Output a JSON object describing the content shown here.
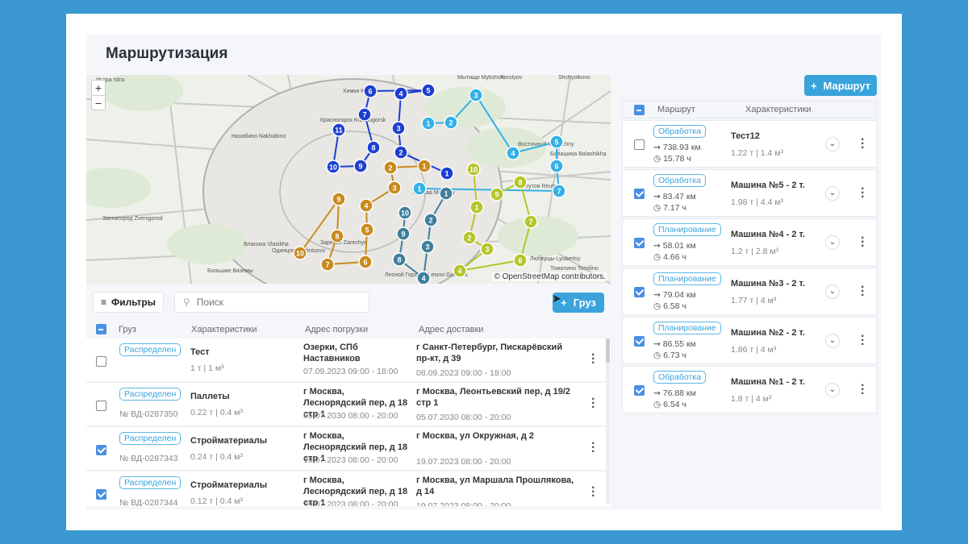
{
  "page": {
    "title": "Маршрутизация"
  },
  "map": {
    "zoom_in": "+",
    "zoom_out": "−",
    "attribution": "© OpenStreetMap contributors.",
    "labels": [
      "Истра Istra",
      "Химки Khimki",
      "Мытищи Mytishchi",
      "Korolyov",
      "Shchyolkovo",
      "Нахабино Nakhabino",
      "Красногорск Krasnogorsk",
      "Москва Moscow",
      "Восточный Vostochny",
      "Балашиха Balashikha",
      "Реутов Reutov",
      "Звенигород Zvenigorod",
      "Заречье Zarechye",
      "Власиха Vlasikha",
      "Одинцово Odintsovo",
      "Люберцы Lyubertsy",
      "Томилино Tomilino",
      "Лесной Городок Lesnoi Gorodok",
      "Большие Вяземы"
    ],
    "routes": [
      {
        "color": "#1c3fd1",
        "markers": [
          "1",
          "2",
          "3",
          "4",
          "5",
          "6",
          "7",
          "8",
          "9",
          "10",
          "11"
        ]
      },
      {
        "color": "#34b0e8",
        "markers": [
          "1",
          "2",
          "3",
          "4",
          "5",
          "6",
          "7",
          "1"
        ]
      },
      {
        "color": "#c98b1e",
        "markers": [
          "1",
          "2",
          "3",
          "4",
          "5",
          "6",
          "7",
          "8",
          "9",
          "10"
        ]
      },
      {
        "color": "#3f7f9e",
        "markers": [
          "1",
          "2",
          "3",
          "4",
          "8",
          "9",
          "10"
        ]
      },
      {
        "color": "#b6c52b",
        "markers": [
          "10",
          "1",
          "2",
          "3",
          "4",
          "6",
          "7",
          "8",
          "9"
        ]
      }
    ]
  },
  "toolbar": {
    "filters": "Фильтры",
    "search_placeholder": "Поиск",
    "add_cargo": "Груз",
    "add_route": "Маршрут"
  },
  "cargo_table": {
    "headers": [
      "Груз",
      "Характеристики",
      "Адрес погрузки",
      "Адрес доставки"
    ],
    "rows": [
      {
        "checked": false,
        "status": "Распределен",
        "number": "",
        "name": "Тест",
        "specs": "1 т | 1 м³",
        "load_addr": "Озерки, СПб Наставников",
        "load_time": "07.09.2023 09:00 - 18:00",
        "del_addr": "г Санкт-Петербург, Пискарёвский пр-кт, д 39",
        "del_time": "08.09.2023 09:00 - 18:00"
      },
      {
        "checked": false,
        "status": "Распределен",
        "number": "№ ВД-0287350",
        "name": "Паллеты",
        "specs": "0.22 т | 0.4 м³",
        "load_addr": "г Москва, Леснорядский пер, д 18 стр 1",
        "load_time": "05.07.2030 08:00 - 20:00",
        "del_addr": "г Москва, Леонтьевский пер, д 19/2 стр 1",
        "del_time": "05.07.2030 08:00 - 20:00"
      },
      {
        "checked": true,
        "status": "Распределен",
        "number": "№ ВД-0287343",
        "name": "Стройматериалы",
        "specs": "0.24 т | 0.4 м³",
        "load_addr": "г Москва, Леснорядский пер, д 18 стр 1",
        "load_time": "19.07.2023 08:00 - 20:00",
        "del_addr": "г Москва, ул Окружная, д 2",
        "del_time": "19.07.2023 08:00 - 20:00"
      },
      {
        "checked": true,
        "status": "Распределен",
        "number": "№ ВД-0287344",
        "name": "Стройматериалы",
        "specs": "0.12 т | 0.4 м³",
        "load_addr": "г Москва, Леснорядский пер, д 18 стр 1",
        "load_time": "19.07.2023 08:00 - 20:00",
        "del_addr": "г Москва, ул Маршала Прошлякова, д 14",
        "del_time": "19.07.2023 08:00 - 20:00"
      }
    ]
  },
  "routes_panel": {
    "headers": [
      "Маршрут",
      "Характеристики"
    ],
    "rows": [
      {
        "checked": false,
        "status": "Обработка",
        "distance": "738.93 км",
        "duration": "15.78 ч",
        "name": "Тест12",
        "specs": "1.22 т | 1.4 м³"
      },
      {
        "checked": true,
        "status": "Обработка",
        "distance": "83.47 км",
        "duration": "7.17 ч",
        "name": "Машина №5 - 2 т.",
        "specs": "1.98 т | 4.4 м³"
      },
      {
        "checked": true,
        "status": "Планирование",
        "distance": "58.01 км",
        "duration": "4.66 ч",
        "name": "Машина №4 - 2 т.",
        "specs": "1.2 т | 2.8 м³"
      },
      {
        "checked": true,
        "status": "Планирование",
        "distance": "79.04 км",
        "duration": "6.58 ч",
        "name": "Машина №3 - 2 т.",
        "specs": "1.77 т | 4 м³"
      },
      {
        "checked": true,
        "status": "Планирование",
        "distance": "86.55 км",
        "duration": "6.73 ч",
        "name": "Машина №2 - 2 т.",
        "specs": "1.86 т | 4 м³"
      },
      {
        "checked": true,
        "status": "Обработка",
        "distance": "76.88 км",
        "duration": "6.54 ч",
        "name": "Машина №1 - 2 т.",
        "specs": "1.8 т | 4 м³"
      }
    ]
  }
}
